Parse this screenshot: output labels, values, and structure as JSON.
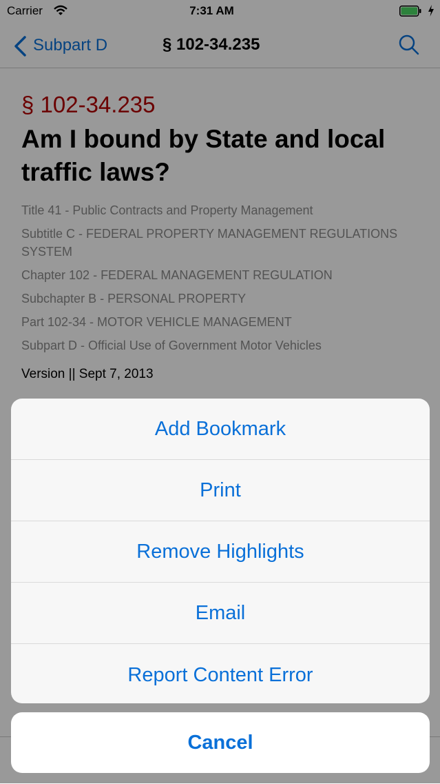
{
  "status_bar": {
    "carrier": "Carrier",
    "time": "7:31 AM",
    "battery_color": "#4cd964"
  },
  "nav": {
    "back_label": "Subpart D",
    "title": "§ 102-34.235",
    "icons": [
      "back-chevron-icon",
      "search-icon"
    ]
  },
  "document": {
    "section_number": "§ 102-34.235",
    "heading": "Am I bound by State and local traffic laws?",
    "hierarchy": [
      "Title 41 - Public Contracts and Property Management",
      "Subtitle C - FEDERAL PROPERTY MANAGEMENT REGULATIONS SYSTEM",
      "Chapter 102 - FEDERAL MANAGEMENT REGULATION",
      "Subchapter B - PERSONAL PROPERTY",
      "Part 102-34 - MOTOR VEHICLE MANAGEMENT",
      "Subpart D - Official Use of Government Motor Vehicles"
    ],
    "version": "Version || Sept 7, 2013"
  },
  "action_sheet": {
    "items": [
      {
        "label": "Add Bookmark"
      },
      {
        "label": "Print"
      },
      {
        "label": "Remove Highlights"
      },
      {
        "label": "Email"
      },
      {
        "label": "Report Content Error"
      }
    ],
    "cancel_label": "Cancel"
  },
  "colors": {
    "accent": "#0a70d8",
    "section_number": "#b30000"
  }
}
